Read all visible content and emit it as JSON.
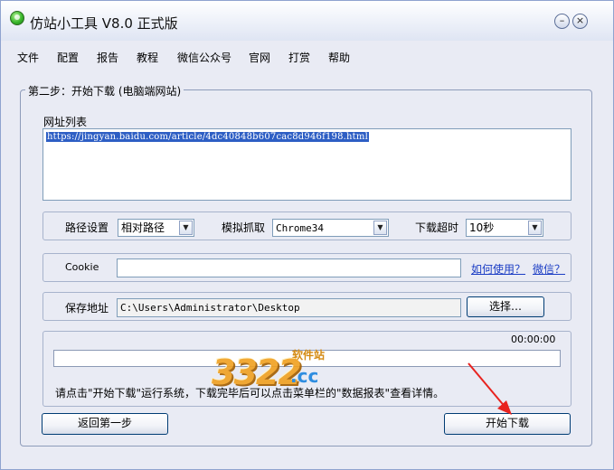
{
  "window": {
    "title": "仿站小工具 V8.0 正式版",
    "minimize_glyph": "–",
    "close_glyph": "×"
  },
  "menu": [
    "文件",
    "配置",
    "报告",
    "教程",
    "微信公众号",
    "官网",
    "打赏",
    "帮助"
  ],
  "step": {
    "legend": "第二步：开始下载 (电脑端网站)"
  },
  "url_list": {
    "label": "网址列表",
    "selected_url": "https://jingyan.baidu.com/article/4dc40848b607cac8d946f198.html"
  },
  "settings": {
    "path_label": "路径设置",
    "path_value": "相对路径",
    "simulate_label": "模拟抓取",
    "simulate_value": "Chrome34",
    "timeout_label": "下载超时",
    "timeout_value": "10秒"
  },
  "cookie": {
    "label": "Cookie",
    "value": "",
    "how_to_link": "如何使用？",
    "wechat_link": "微信？"
  },
  "save": {
    "label": "保存地址",
    "path": "C:\\Users\\Administrator\\Desktop",
    "choose_button": "选择…"
  },
  "progress": {
    "elapsed": "00:00:00",
    "fraction": 0,
    "hint": "请点击\"开始下载\"运行系统，下载完毕后可以点击菜单栏的\"数据报表\"查看详情。"
  },
  "buttons": {
    "back": "返回第一步",
    "start": "开始下载"
  },
  "watermark": {
    "digits": "3322",
    "tld": ".cc",
    "site": "软件站"
  },
  "colors": {
    "selection": "#2d5ec4",
    "link": "#1a3cc4",
    "annotation_arrow": "#e8231f"
  }
}
